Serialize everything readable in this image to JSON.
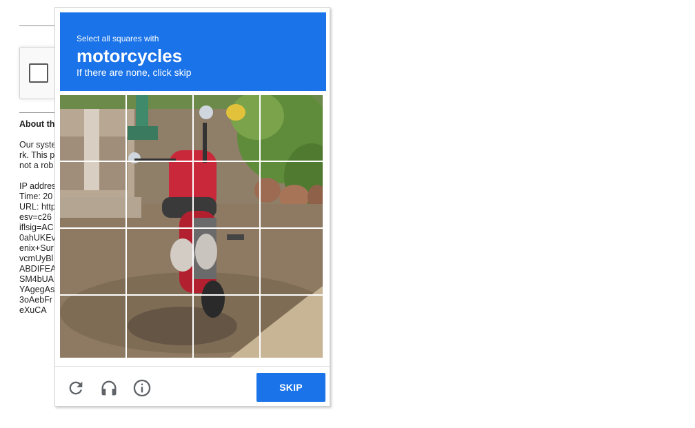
{
  "background": {
    "about_title": "About th",
    "about_lines_1": [
      "Our syste",
      "rk. This p",
      "not a rob"
    ],
    "about_lines_2": [
      "IP addres",
      "Time: 20",
      "URL: http",
      "esv=c26",
      "iflsig=AC",
      "0ahUKEv",
      "enix+Sur",
      "vcmUyBl",
      "ABDIFEA",
      "SM4bUA",
      "YAgegAs",
      "3oAebFr",
      "eXuCA"
    ]
  },
  "challenge": {
    "instruction_small": "Select all squares with",
    "target_object": "motorcycles",
    "instruction_hint": "If there are none, click skip",
    "grid": {
      "rows": 4,
      "cols": 4
    },
    "footer": {
      "reload_icon": "reload-icon",
      "audio_icon": "headphones-icon",
      "info_icon": "info-icon",
      "skip_label": "SKIP"
    }
  },
  "colors": {
    "accent": "#1a73e8",
    "icon_gray": "#5f6368"
  }
}
